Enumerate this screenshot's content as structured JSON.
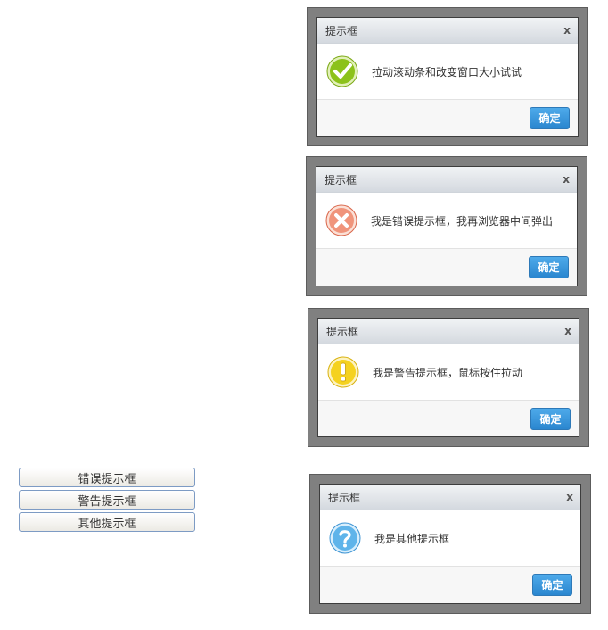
{
  "buttons": [
    {
      "label": "错误提示框"
    },
    {
      "label": "警告提示框"
    },
    {
      "label": "其他提示框"
    }
  ],
  "dialogs": [
    {
      "title": "提示框",
      "close": "x",
      "message": "拉动滚动条和改变窗口大小试试",
      "ok": "确定",
      "icon": "success-check-icon",
      "icon_color": "#8cc21a"
    },
    {
      "title": "提示框",
      "close": "x",
      "message": "我是错误提示框，我再浏览器中间弹出",
      "ok": "确定",
      "icon": "error-x-icon",
      "icon_color": "#f0947b"
    },
    {
      "title": "提示框",
      "close": "x",
      "message": "我是警告提示框，鼠标按住拉动",
      "ok": "确定",
      "icon": "warning-exclamation-icon",
      "icon_color": "#f5d21f"
    },
    {
      "title": "提示框",
      "close": "x",
      "message": "我是其他提示框",
      "ok": "确定",
      "icon": "question-icon",
      "icon_color": "#5fb4ea"
    }
  ]
}
